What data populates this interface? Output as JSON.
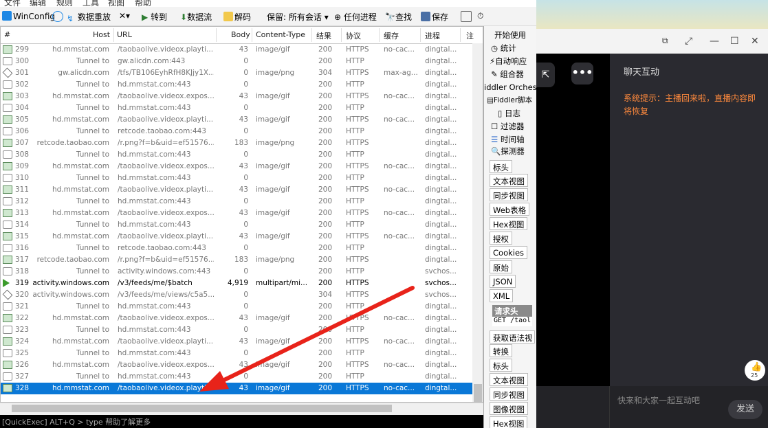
{
  "menu": [
    "文件",
    "编辑",
    "规则",
    "工具",
    "视图",
    "帮助"
  ],
  "toolbar": {
    "win_config": "WinConfig",
    "replay": "数据重放",
    "goto": "转到",
    "stream": "数据流",
    "decode": "解码",
    "keep": "保留: 所有会话",
    "any_process": "任何进程",
    "find": "查找",
    "save": "保存"
  },
  "columns": [
    "#",
    "Host",
    "URL",
    "Body",
    "Content-Type",
    "结果",
    "协议",
    "缓存",
    "进程",
    "注"
  ],
  "sessions": [
    {
      "id": "299",
      "host": "hd.mmstat.com",
      "url": "/taobaolive.videox.playti...",
      "body": "43",
      "ctype": "image/gif",
      "result": "200",
      "proto": "HTTPS",
      "cache": "no-cac...",
      "proc": "dingtal...",
      "icon": "img"
    },
    {
      "id": "300",
      "host": "Tunnel to",
      "url": "gw.alicdn.com:443",
      "body": "0",
      "ctype": "",
      "result": "200",
      "proto": "HTTP",
      "cache": "",
      "proc": "dingtal...",
      "icon": "lock"
    },
    {
      "id": "301",
      "host": "gw.alicdn.com",
      "url": "/tfs/TB106EyhRfH8KJjy1X...",
      "body": "0",
      "ctype": "image/png",
      "result": "304",
      "proto": "HTTPS",
      "cache": "max-ag...",
      "proc": "dingtal...",
      "icon": "dia"
    },
    {
      "id": "302",
      "host": "Tunnel to",
      "url": "hd.mmstat.com:443",
      "body": "0",
      "ctype": "",
      "result": "200",
      "proto": "HTTP",
      "cache": "",
      "proc": "dingtal...",
      "icon": "lock"
    },
    {
      "id": "303",
      "host": "hd.mmstat.com",
      "url": "/taobaolive.videox.expos...",
      "body": "43",
      "ctype": "image/gif",
      "result": "200",
      "proto": "HTTPS",
      "cache": "no-cac...",
      "proc": "dingtal...",
      "icon": "img"
    },
    {
      "id": "304",
      "host": "Tunnel to",
      "url": "hd.mmstat.com:443",
      "body": "0",
      "ctype": "",
      "result": "200",
      "proto": "HTTP",
      "cache": "",
      "proc": "dingtal...",
      "icon": "lock"
    },
    {
      "id": "305",
      "host": "hd.mmstat.com",
      "url": "/taobaolive.videox.playti...",
      "body": "43",
      "ctype": "image/gif",
      "result": "200",
      "proto": "HTTPS",
      "cache": "no-cac...",
      "proc": "dingtal...",
      "icon": "img"
    },
    {
      "id": "306",
      "host": "Tunnel to",
      "url": "retcode.taobao.com:443",
      "body": "0",
      "ctype": "",
      "result": "200",
      "proto": "HTTP",
      "cache": "",
      "proc": "dingtal...",
      "icon": "lock"
    },
    {
      "id": "307",
      "host": "retcode.taobao.com",
      "url": "/r.png?f=b&uid=ef51576...",
      "body": "183",
      "ctype": "image/png",
      "result": "200",
      "proto": "HTTPS",
      "cache": "",
      "proc": "dingtal...",
      "icon": "img"
    },
    {
      "id": "308",
      "host": "Tunnel to",
      "url": "hd.mmstat.com:443",
      "body": "0",
      "ctype": "",
      "result": "200",
      "proto": "HTTP",
      "cache": "",
      "proc": "dingtal...",
      "icon": "lock"
    },
    {
      "id": "309",
      "host": "hd.mmstat.com",
      "url": "/taobaolive.videox.expos...",
      "body": "43",
      "ctype": "image/gif",
      "result": "200",
      "proto": "HTTPS",
      "cache": "no-cac...",
      "proc": "dingtal...",
      "icon": "img"
    },
    {
      "id": "310",
      "host": "Tunnel to",
      "url": "hd.mmstat.com:443",
      "body": "0",
      "ctype": "",
      "result": "200",
      "proto": "HTTP",
      "cache": "",
      "proc": "dingtal...",
      "icon": "lock"
    },
    {
      "id": "311",
      "host": "hd.mmstat.com",
      "url": "/taobaolive.videox.playti...",
      "body": "43",
      "ctype": "image/gif",
      "result": "200",
      "proto": "HTTPS",
      "cache": "no-cac...",
      "proc": "dingtal...",
      "icon": "img"
    },
    {
      "id": "312",
      "host": "Tunnel to",
      "url": "hd.mmstat.com:443",
      "body": "0",
      "ctype": "",
      "result": "200",
      "proto": "HTTP",
      "cache": "",
      "proc": "dingtal...",
      "icon": "lock"
    },
    {
      "id": "313",
      "host": "hd.mmstat.com",
      "url": "/taobaolive.videox.expos...",
      "body": "43",
      "ctype": "image/gif",
      "result": "200",
      "proto": "HTTPS",
      "cache": "no-cac...",
      "proc": "dingtal...",
      "icon": "img"
    },
    {
      "id": "314",
      "host": "Tunnel to",
      "url": "hd.mmstat.com:443",
      "body": "0",
      "ctype": "",
      "result": "200",
      "proto": "HTTP",
      "cache": "",
      "proc": "dingtal...",
      "icon": "lock"
    },
    {
      "id": "315",
      "host": "hd.mmstat.com",
      "url": "/taobaolive.videox.playti...",
      "body": "43",
      "ctype": "image/gif",
      "result": "200",
      "proto": "HTTPS",
      "cache": "no-cac...",
      "proc": "dingtal...",
      "icon": "img"
    },
    {
      "id": "316",
      "host": "Tunnel to",
      "url": "retcode.taobao.com:443",
      "body": "0",
      "ctype": "",
      "result": "200",
      "proto": "HTTP",
      "cache": "",
      "proc": "dingtal...",
      "icon": "lock"
    },
    {
      "id": "317",
      "host": "retcode.taobao.com",
      "url": "/r.png?f=b&uid=ef51576...",
      "body": "183",
      "ctype": "image/png",
      "result": "200",
      "proto": "HTTPS",
      "cache": "",
      "proc": "dingtal...",
      "icon": "img"
    },
    {
      "id": "318",
      "host": "Tunnel to",
      "url": "activity.windows.com:443",
      "body": "0",
      "ctype": "",
      "result": "200",
      "proto": "HTTP",
      "cache": "",
      "proc": "svchos...",
      "icon": "lock"
    },
    {
      "id": "319",
      "host": "activity.windows.com",
      "url": "/v3/feeds/me/$batch",
      "body": "4,919",
      "ctype": "multipart/mi...",
      "result": "200",
      "proto": "HTTPS",
      "cache": "",
      "proc": "svchos...",
      "icon": "arrow",
      "bold": true
    },
    {
      "id": "320",
      "host": "activity.windows.com",
      "url": "/v3/feeds/me/views/c5a5...",
      "body": "0",
      "ctype": "",
      "result": "304",
      "proto": "HTTPS",
      "cache": "",
      "proc": "svchos...",
      "icon": "dia"
    },
    {
      "id": "321",
      "host": "Tunnel to",
      "url": "hd.mmstat.com:443",
      "body": "0",
      "ctype": "",
      "result": "200",
      "proto": "HTTP",
      "cache": "",
      "proc": "dingtal...",
      "icon": "lock"
    },
    {
      "id": "322",
      "host": "hd.mmstat.com",
      "url": "/taobaolive.videox.expos...",
      "body": "43",
      "ctype": "image/gif",
      "result": "200",
      "proto": "HTTPS",
      "cache": "no-cac...",
      "proc": "dingtal...",
      "icon": "img"
    },
    {
      "id": "323",
      "host": "Tunnel to",
      "url": "hd.mmstat.com:443",
      "body": "0",
      "ctype": "",
      "result": "200",
      "proto": "HTTP",
      "cache": "",
      "proc": "dingtal...",
      "icon": "lock"
    },
    {
      "id": "324",
      "host": "hd.mmstat.com",
      "url": "/taobaolive.videox.playti...",
      "body": "43",
      "ctype": "image/gif",
      "result": "200",
      "proto": "HTTPS",
      "cache": "no-cac...",
      "proc": "dingtal...",
      "icon": "img"
    },
    {
      "id": "325",
      "host": "Tunnel to",
      "url": "hd.mmstat.com:443",
      "body": "0",
      "ctype": "",
      "result": "200",
      "proto": "HTTP",
      "cache": "",
      "proc": "dingtal...",
      "icon": "lock"
    },
    {
      "id": "326",
      "host": "hd.mmstat.com",
      "url": "/taobaolive.videox.expos...",
      "body": "43",
      "ctype": "image/gif",
      "result": "200",
      "proto": "HTTPS",
      "cache": "no-cac...",
      "proc": "dingtal...",
      "icon": "img"
    },
    {
      "id": "327",
      "host": "Tunnel to",
      "url": "hd.mmstat.com:443",
      "body": "0",
      "ctype": "",
      "result": "200",
      "proto": "HTTP",
      "cache": "",
      "proc": "dingtal...",
      "icon": "lock"
    },
    {
      "id": "328",
      "host": "hd.mmstat.com",
      "url": "/taobaolive.videox.playti...",
      "body": "43",
      "ctype": "image/gif",
      "result": "200",
      "proto": "HTTPS",
      "cache": "no-cac...",
      "proc": "dingtal...",
      "icon": "img",
      "selected": true
    }
  ],
  "quickexec": "[QuickExec] ALT+Q > type 帮助了解更多",
  "panel": {
    "top_items": [
      "开始使用",
      "统计",
      "自动响应",
      "组合器",
      "iddler Orchestr",
      "Fiddler脚本",
      "日志",
      "过滤器",
      "时间轴",
      "探测器"
    ],
    "request_tabs": [
      "标头",
      "文本视图",
      "同步视图",
      "Web表格",
      "Hex视图",
      "授权",
      "Cookies",
      "原始",
      "JSON",
      "XML"
    ],
    "request_header_title": "请求头",
    "request_line": "GET /taol",
    "response_tabs": [
      "获取语法视",
      "转换",
      "标头",
      "文本视图",
      "同步视图",
      "图像视图",
      "Hex视图"
    ]
  },
  "live": {
    "chat_title": "聊天互动",
    "system_notice": "系统提示：主播回来啦，直播内容即将恢复",
    "like_count": "25",
    "input_placeholder": "快来和大家一起互动吧",
    "send": "发送",
    "more_icon": "more-icon"
  },
  "colors": {
    "selected_row": "#0a78d7",
    "annotation_arrow": "#e8231a",
    "system_notice": "#ff8a3d"
  }
}
